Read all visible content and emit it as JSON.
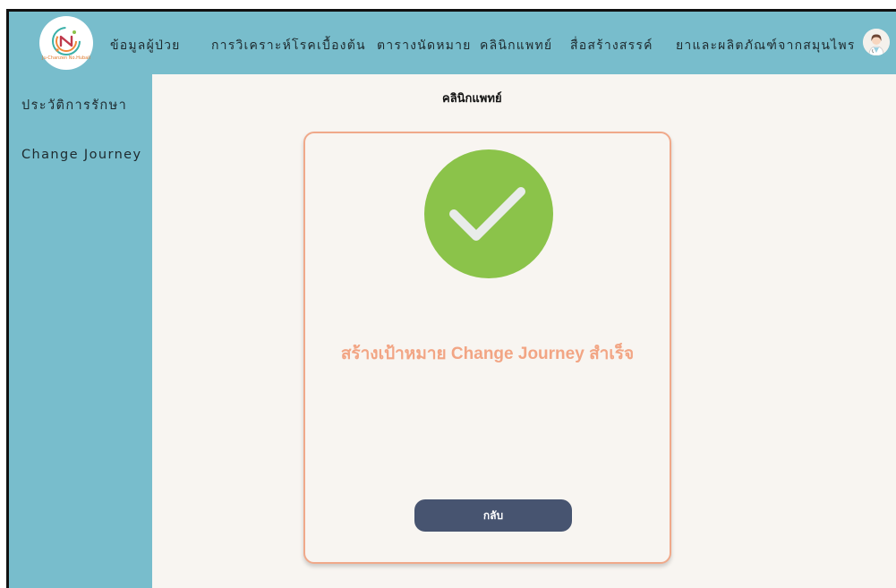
{
  "header": {
    "logo_text": "Ju-Chanzen No.Hubali",
    "nav_items": [
      "ข้อมูลผู้ป่วย",
      "การวิเคราะห์โรคเบื้องต้น",
      "ตารางนัดหมาย",
      "คลินิกแพทย์",
      "สื่อสร้างสรรค์",
      "ยาและผลิตภัณฑ์จากสมุนไพร"
    ],
    "avatar_icon": "doctor-avatar-icon"
  },
  "sidebar": {
    "items": [
      "ประวัติการรักษา",
      "Change Journey"
    ]
  },
  "main": {
    "title": "คลินิกแพทย์",
    "success_icon": "check-circle-icon",
    "success_message": "สร้างเป้าหมาย Change Journey สำเร็จ",
    "back_label": "กลับ"
  },
  "colors": {
    "nav_bg": "#78bdcc",
    "content_bg": "#f8f5f1",
    "card_border": "#f0a98a",
    "success_green": "#8bc34a",
    "message_color": "#f2a584",
    "button_bg": "#475470"
  }
}
